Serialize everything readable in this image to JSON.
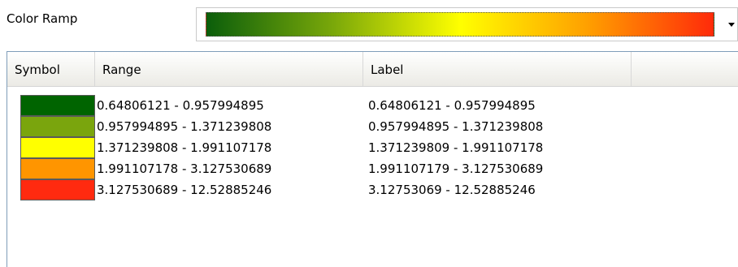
{
  "ramp": {
    "label": "Color Ramp",
    "colors": [
      "#0b5e0b",
      "#7aa80a",
      "#ffff00",
      "#ffa000",
      "#ff2a0a"
    ]
  },
  "table": {
    "columns": [
      "Symbol",
      "Range",
      "Label"
    ],
    "rows": [
      {
        "color": "#006400",
        "range": "0.64806121 - 0.957994895",
        "label": "0.64806121 - 0.957994895"
      },
      {
        "color": "#7aa50d",
        "range": "0.957994895 - 1.371239808",
        "label": "0.957994895 - 1.371239808"
      },
      {
        "color": "#ffff00",
        "range": "1.371239808 - 1.991107178",
        "label": "1.371239809 - 1.991107178"
      },
      {
        "color": "#ff9500",
        "range": "1.991107178 - 3.127530689",
        "label": "1.991107179 - 3.127530689"
      },
      {
        "color": "#ff2a0f",
        "range": "3.127530689 - 12.52885246",
        "label": "3.12753069 - 12.52885246"
      }
    ]
  }
}
